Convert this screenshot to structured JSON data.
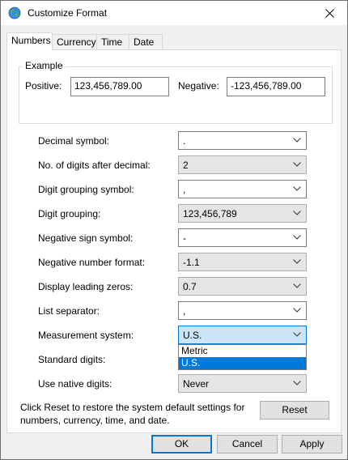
{
  "window": {
    "title": "Customize Format",
    "icon": "globe-icon"
  },
  "tabs": [
    {
      "label": "Numbers",
      "active": true
    },
    {
      "label": "Currency",
      "active": false
    },
    {
      "label": "Time",
      "active": false
    },
    {
      "label": "Date",
      "active": false
    }
  ],
  "example": {
    "group_label": "Example",
    "positive_label": "Positive:",
    "positive_value": "123,456,789.00",
    "negative_label": "Negative:",
    "negative_value": "-123,456,789.00"
  },
  "settings": [
    {
      "label": "Decimal symbol:",
      "value": ".",
      "readonly": false
    },
    {
      "label": "No. of digits after decimal:",
      "value": "2",
      "readonly": true
    },
    {
      "label": "Digit grouping symbol:",
      "value": ",",
      "readonly": false
    },
    {
      "label": "Digit grouping:",
      "value": "123,456,789",
      "readonly": true
    },
    {
      "label": "Negative sign symbol:",
      "value": "-",
      "readonly": false
    },
    {
      "label": "Negative number format:",
      "value": "-1.1",
      "readonly": true
    },
    {
      "label": "Display leading zeros:",
      "value": "0.7",
      "readonly": true
    },
    {
      "label": "List separator:",
      "value": ",",
      "readonly": false
    },
    {
      "label": "Measurement system:",
      "value": "U.S.",
      "readonly": true,
      "open": true
    },
    {
      "label": "Standard digits:",
      "value": "",
      "readonly": true
    },
    {
      "label": "Use native digits:",
      "value": "Never",
      "readonly": true
    }
  ],
  "measurement_options": [
    "Metric",
    "U.S."
  ],
  "measurement_selected": "U.S.",
  "reset": {
    "note": "Click Reset to restore the system default settings for numbers, currency, time, and date.",
    "button": "Reset"
  },
  "footer": {
    "ok": "OK",
    "cancel": "Cancel",
    "apply": "Apply"
  },
  "colors": {
    "accent": "#0078d7",
    "highlight": "#cce4f7",
    "disabled_bg": "#e5e5e5"
  }
}
